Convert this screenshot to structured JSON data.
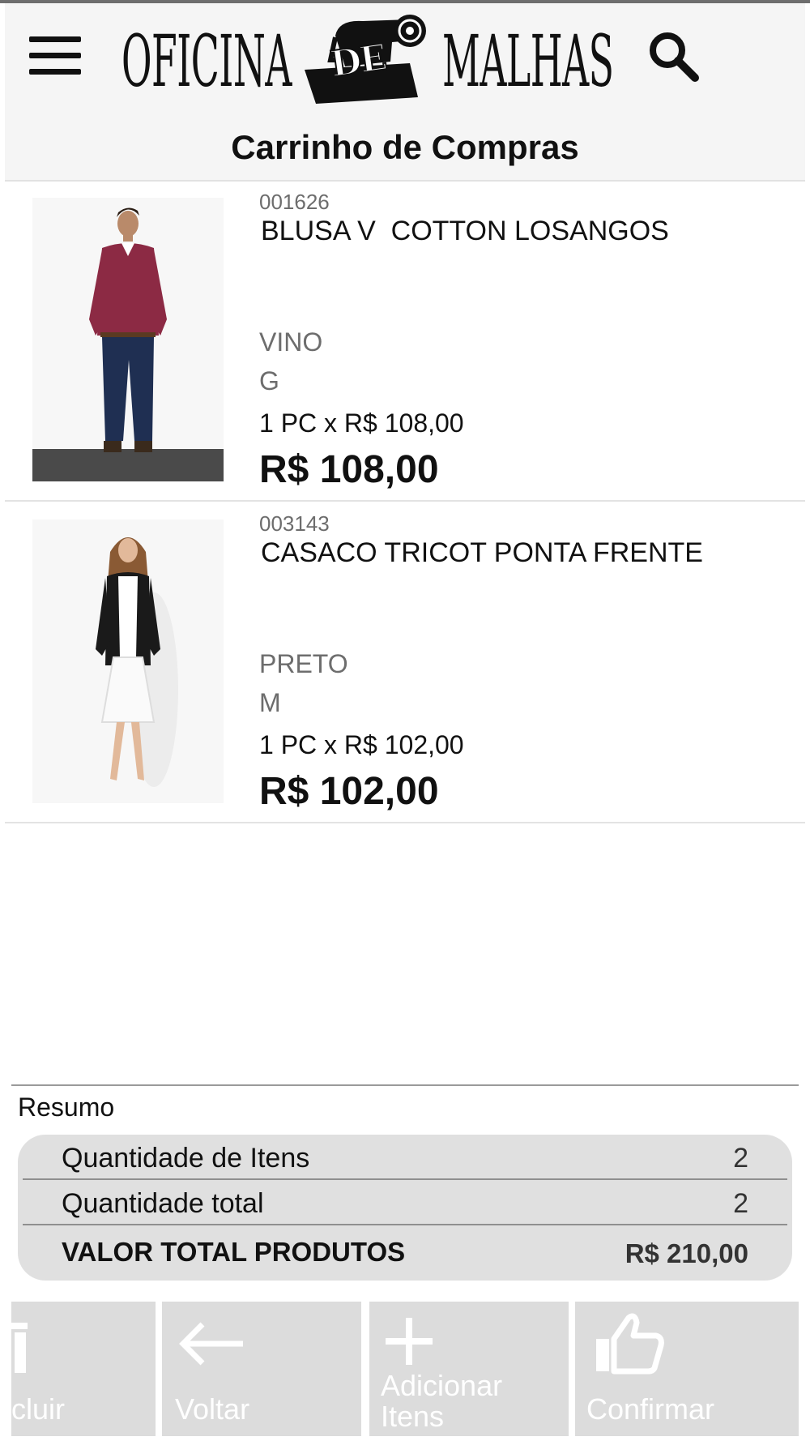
{
  "header": {
    "logo_left": "OFICINA",
    "logo_middle": "DE",
    "logo_right": "MALHAS",
    "menu_icon": "hamburger-menu-icon",
    "search_icon": "search-icon"
  },
  "page_title": "Carrinho de Compras",
  "cart_items": [
    {
      "code": "001626",
      "name": "BLUSA V  COTTON LOSANGOS",
      "color": "VINO",
      "size": "G",
      "quantity_line": "1 PC x R$ 108,00",
      "subtotal": "R$ 108,00"
    },
    {
      "code": "003143",
      "name": "CASACO TRICOT PONTA FRENTE",
      "color": "PRETO",
      "size": "M",
      "quantity_line": "1 PC x R$ 102,00",
      "subtotal": "R$ 102,00"
    }
  ],
  "summary": {
    "heading": "Resumo",
    "rows": [
      {
        "label": "Quantidade de Itens",
        "value": "2"
      },
      {
        "label": "Quantidade total",
        "value": "2"
      },
      {
        "label": "VALOR TOTAL PRODUTOS",
        "value": "R$ 210,00"
      }
    ]
  },
  "actions": {
    "excluir": {
      "label": "cluir",
      "icon": "trash-icon"
    },
    "voltar": {
      "label": "Voltar",
      "icon": "arrow-left-icon"
    },
    "adicionar": {
      "label_line1": "Adicionar",
      "label_line2": "Itens",
      "icon": "plus-icon"
    },
    "confirmar": {
      "label": "Confirmar",
      "icon": "thumbs-up-icon"
    }
  },
  "colors": {
    "header_bg": "#f5f5f5",
    "summary_bg": "#e0e0e0",
    "action_bg": "#dcdcdc",
    "action_text": "#ffffff",
    "product1_sweater": "#8c2a44",
    "product2_cardigan": "#1a1a1a"
  }
}
